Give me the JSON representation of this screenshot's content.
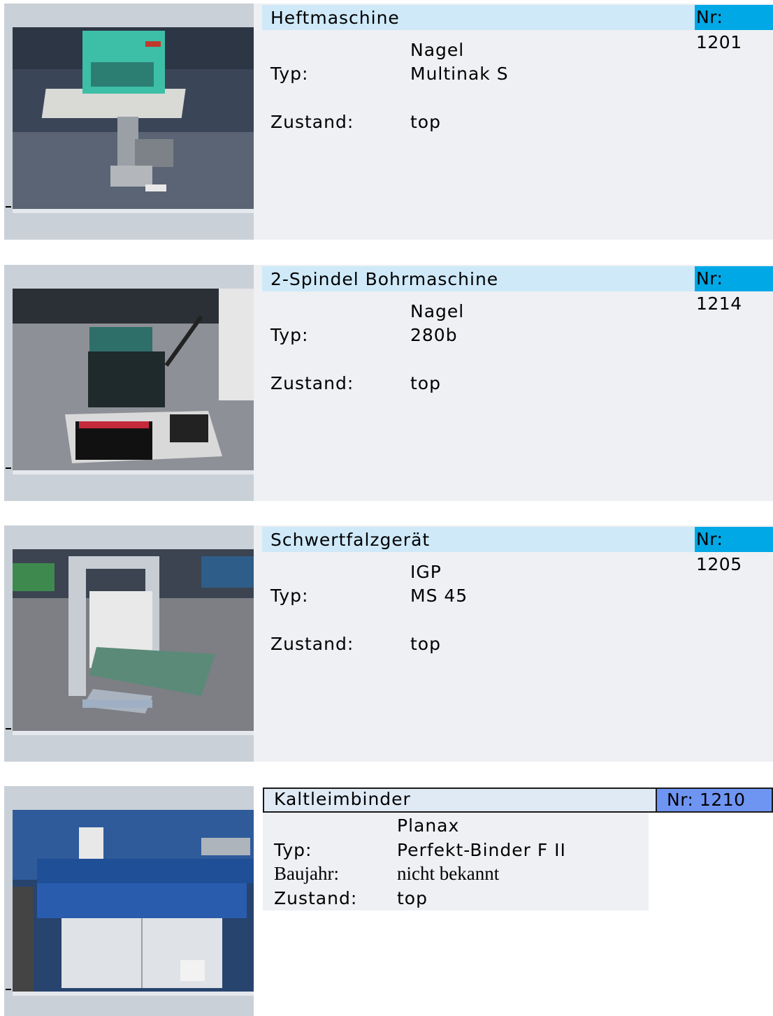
{
  "listings": [
    {
      "title": "Heftmaschine",
      "nr": "Nr: 1201",
      "manufacturer": "Nagel",
      "typ_label": "Typ:",
      "typ": "Multinak S",
      "zustand_label": "Zustand:",
      "zustand": "top",
      "photo": "stapling-machine-photo"
    },
    {
      "title": "2-Spindel Bohrmaschine",
      "nr": "Nr: 1214",
      "manufacturer": "Nagel",
      "typ_label": "Typ:",
      "typ": "280b",
      "zustand_label": "Zustand:",
      "zustand": "top",
      "photo": "drilling-machine-photo"
    },
    {
      "title": "Schwertfalzgerät",
      "nr": "Nr: 1205",
      "manufacturer": "IGP",
      "typ_label": "Typ:",
      "typ": "MS 45",
      "zustand_label": "Zustand:",
      "zustand": "top",
      "photo": "folding-machine-photo"
    },
    {
      "title": "Kaltleimbinder",
      "nr": "Nr: 1210",
      "manufacturer": "Planax",
      "typ_label": "Typ:",
      "typ": "Perfekt-Binder F II",
      "baujahr_label": "Baujahr:",
      "baujahr": "nicht bekannt",
      "zustand_label": "Zustand:",
      "zustand": "top",
      "photo": "binding-machine-photo"
    }
  ],
  "colors": {
    "title_bar": "#cfe9f9",
    "nr_badge": "#00a8e6",
    "nr_badge_alt": "#6f95f3",
    "photo_column": "#c9d0d7",
    "info_column": "#eef0f3"
  }
}
